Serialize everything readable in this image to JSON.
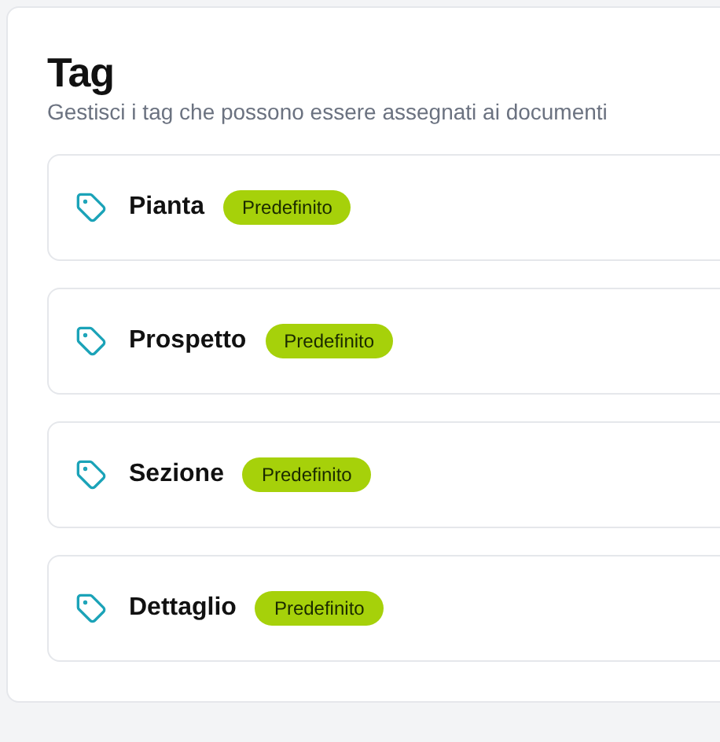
{
  "header": {
    "title": "Tag",
    "subtitle": "Gestisci i tag che possono essere assegnati ai documenti"
  },
  "tags": [
    {
      "name": "Pianta",
      "badge": "Predefinito"
    },
    {
      "name": "Prospetto",
      "badge": "Predefinito"
    },
    {
      "name": "Sezione",
      "badge": "Predefinito"
    },
    {
      "name": "Dettaglio",
      "badge": "Predefinito"
    }
  ]
}
